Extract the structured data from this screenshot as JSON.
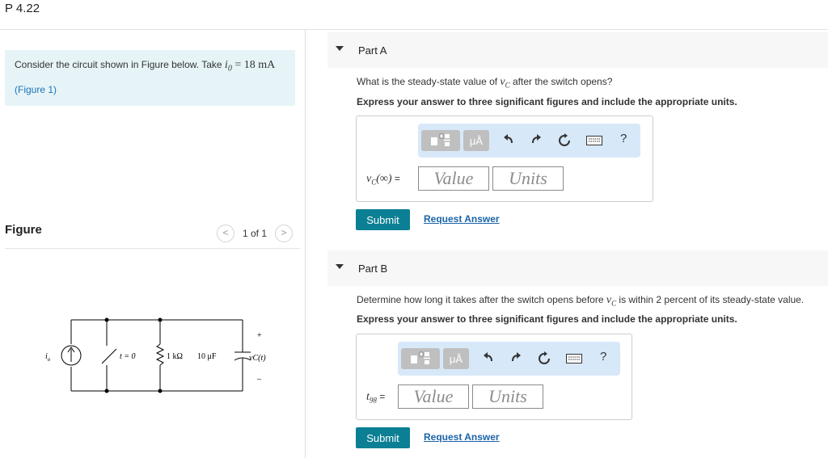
{
  "problem": {
    "title": "P 4.22"
  },
  "intro": {
    "text": "Consider the circuit shown in Figure below. Take ",
    "math_var": "i",
    "math_sub": "0",
    "math_rest": " = 18 mA",
    "figure_link": "(Figure 1)"
  },
  "figure": {
    "label": "Figure",
    "pager": {
      "prev": "<",
      "count": "1 of 1",
      "next": ">"
    },
    "circuit": {
      "source_label": "i",
      "source_sub": "o",
      "switch_label": "t = 0",
      "resistor_label": "1 kΩ",
      "capacitor_label": "10 μF",
      "voltage_label": "vC(t)",
      "plus": "+",
      "minus": "–"
    }
  },
  "parts": [
    {
      "title": "Part A",
      "question_pre": "What is the steady-state value of ",
      "question_var": "v",
      "question_sub": "C",
      "question_post": " after the switch opens?",
      "instructions": "Express your answer to three significant figures and include the appropriate units.",
      "var_main": "v",
      "var_sub": "C",
      "var_arg": "(∞)",
      "equals": " =",
      "value_placeholder": "Value",
      "units_placeholder": "Units",
      "units_symbol": "μÅ",
      "help": "?",
      "submit": "Submit",
      "request": "Request Answer"
    },
    {
      "title": "Part B",
      "question_pre": "Determine how long it takes after the switch opens before ",
      "question_var": "v",
      "question_sub": "C",
      "question_post": " is within 2 percent of its steady-state value.",
      "instructions": "Express your answer to three significant figures and include the appropriate units.",
      "var_main": "t",
      "var_sub": "98",
      "var_arg": "",
      "equals": " =",
      "value_placeholder": "Value",
      "units_placeholder": "Units",
      "units_symbol": "μÅ",
      "help": "?",
      "submit": "Submit",
      "request": "Request Answer"
    }
  ],
  "icons": {
    "undo": "undo-arrow-icon",
    "redo": "redo-arrow-icon",
    "reset": "reset-icon",
    "keyboard": "keyboard-icon",
    "templates": "templates-icon"
  },
  "colors": {
    "intro_bg": "#e6f4f7",
    "toolbar_bg": "#d7e8f8",
    "submit_bg": "#0b7f94",
    "link": "#1a73b8"
  }
}
